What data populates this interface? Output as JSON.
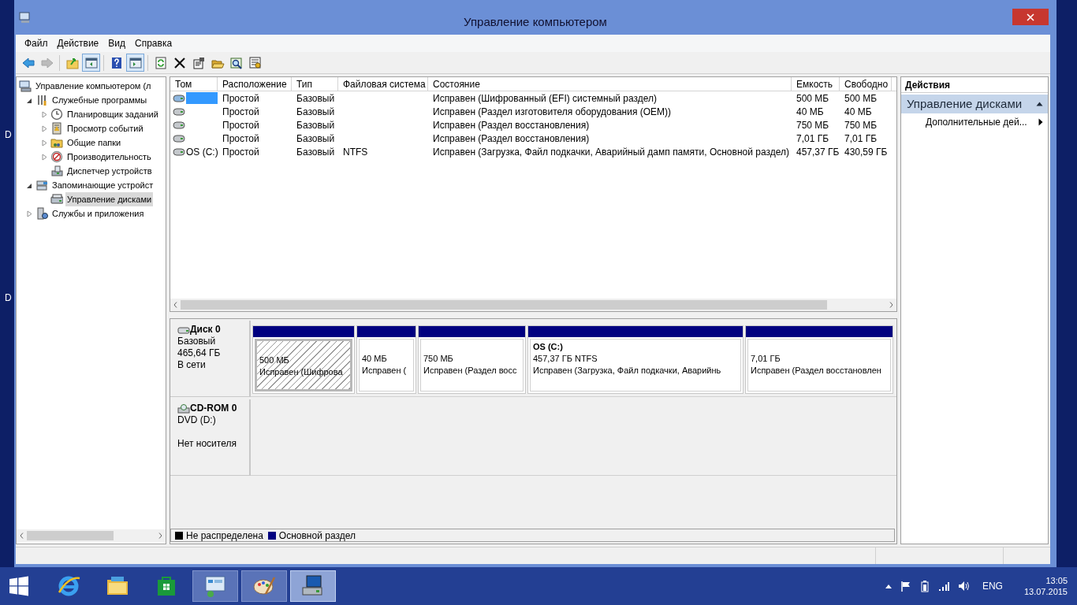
{
  "window": {
    "title": "Управление компьютером"
  },
  "desktop_labels": [
    "D",
    "D"
  ],
  "menu": [
    "Файл",
    "Действие",
    "Вид",
    "Справка"
  ],
  "toolbar": [
    {
      "kind": "back",
      "disabled": false,
      "pressed": false
    },
    {
      "kind": "forward",
      "disabled": true,
      "pressed": false
    },
    {
      "kind": "separator"
    },
    {
      "kind": "up",
      "disabled": false,
      "pressed": false
    },
    {
      "kind": "tree",
      "disabled": false,
      "pressed": true
    },
    {
      "kind": "separator"
    },
    {
      "kind": "help",
      "disabled": false,
      "pressed": false
    },
    {
      "kind": "pane",
      "disabled": false,
      "pressed": true
    },
    {
      "kind": "separator"
    },
    {
      "kind": "refresh",
      "disabled": false,
      "pressed": false
    },
    {
      "kind": "delete",
      "disabled": false,
      "pressed": false
    },
    {
      "kind": "properties",
      "disabled": false,
      "pressed": false
    },
    {
      "kind": "open",
      "disabled": false,
      "pressed": false
    },
    {
      "kind": "find",
      "disabled": false,
      "pressed": false
    },
    {
      "kind": "config",
      "disabled": false,
      "pressed": false
    }
  ],
  "tree": [
    {
      "label": "Управление компьютером (л",
      "kind": "computer",
      "selected": false,
      "children": [
        {
          "label": "Служебные программы",
          "kind": "tools",
          "expanded": true,
          "selected": false,
          "children": [
            {
              "label": "Планировщик заданий",
              "kind": "clock",
              "expanded": false,
              "selected": false
            },
            {
              "label": "Просмотр событий",
              "kind": "events",
              "expanded": false,
              "selected": false
            },
            {
              "label": "Общие папки",
              "kind": "folder",
              "expanded": false,
              "selected": false
            },
            {
              "label": "Производительность",
              "kind": "perf",
              "expanded": false,
              "selected": false
            },
            {
              "label": "Диспетчер устройств",
              "kind": "devices",
              "selected": false
            }
          ]
        },
        {
          "label": "Запоминающие устройст",
          "kind": "storage",
          "expanded": true,
          "selected": false,
          "children": [
            {
              "label": "Управление дисками",
              "kind": "disk",
              "selected": true
            }
          ]
        },
        {
          "label": "Службы и приложения",
          "kind": "services",
          "expanded": false,
          "selected": false
        }
      ]
    }
  ],
  "volumes": {
    "columns": [
      "Том",
      "Расположение",
      "Тип",
      "Файловая система",
      "Состояние",
      "Емкость",
      "Свободно"
    ],
    "rows": [
      {
        "selected": true,
        "cells": [
          null,
          "Простой",
          "Базовый",
          null,
          "Исправен (Шифрованный (EFI) системный раздел)",
          "500 МБ",
          "500 МБ"
        ]
      },
      {
        "selected": false,
        "cells": [
          null,
          "Простой",
          "Базовый",
          null,
          "Исправен (Раздел изготовителя оборудования (OEM))",
          "40 МБ",
          "40 МБ"
        ]
      },
      {
        "selected": false,
        "cells": [
          null,
          "Простой",
          "Базовый",
          null,
          "Исправен (Раздел восстановления)",
          "750 МБ",
          "750 МБ"
        ]
      },
      {
        "selected": false,
        "cells": [
          null,
          "Простой",
          "Базовый",
          null,
          "Исправен (Раздел восстановления)",
          "7,01 ГБ",
          "7,01 ГБ"
        ]
      },
      {
        "selected": false,
        "cells": [
          "OS (C:)",
          "Простой",
          "Базовый",
          "NTFS",
          "Исправен (Загрузка, Файл подкачки, Аварийный дамп памяти, Основной раздел)",
          "457,37 ГБ",
          "430,59 ГБ"
        ]
      }
    ]
  },
  "disks": [
    {
      "kind": "disk",
      "name": "Диск 0",
      "lines": [
        "Базовый",
        "465,64 ГБ"
      ],
      "status": "В сети",
      "partitions": [
        {
          "kind": "primary",
          "selected": true,
          "size": "500 МБ",
          "status": "Исправен (Шифрова"
        },
        {
          "kind": "primary",
          "selected": false,
          "size": "40 МБ",
          "status": "Исправен ("
        },
        {
          "kind": "primary",
          "selected": false,
          "size": "750 МБ",
          "status": "Исправен (Раздел восс"
        },
        {
          "kind": "primary",
          "selected": false,
          "name": "OS  (C:)",
          "size": "457,37 ГБ NTFS",
          "status": "Исправен (Загрузка, Файл подкачки, Аварийнь"
        },
        {
          "kind": "primary",
          "selected": false,
          "size": "7,01 ГБ",
          "status": "Исправен (Раздел восстановлен"
        }
      ]
    },
    {
      "kind": "cdrom",
      "name": "CD-ROM 0",
      "lines": [
        "DVD (D:)"
      ],
      "status": "Нет носителя"
    }
  ],
  "legend": [
    {
      "label": "Не распределена",
      "color": "#000000"
    },
    {
      "label": "Основной раздел",
      "color": "#000080"
    }
  ],
  "actions": {
    "title": "Действия",
    "sections": [
      {
        "title": "Управление дисками",
        "expanded": true,
        "items": [
          {
            "label": "Дополнительные дей...",
            "submenu": true
          }
        ]
      }
    ]
  },
  "taskbar": {
    "apps": [
      {
        "kind": "ie",
        "running": false,
        "selected": false
      },
      {
        "kind": "explorer",
        "running": false,
        "selected": false
      },
      {
        "kind": "store",
        "running": false,
        "selected": false
      },
      {
        "kind": "control",
        "running": true,
        "selected": false
      },
      {
        "kind": "paint",
        "running": true,
        "selected": false
      },
      {
        "kind": "mmc",
        "running": true,
        "selected": true
      }
    ],
    "language": "ENG",
    "time": "13:05",
    "date": "13.07.2015"
  }
}
